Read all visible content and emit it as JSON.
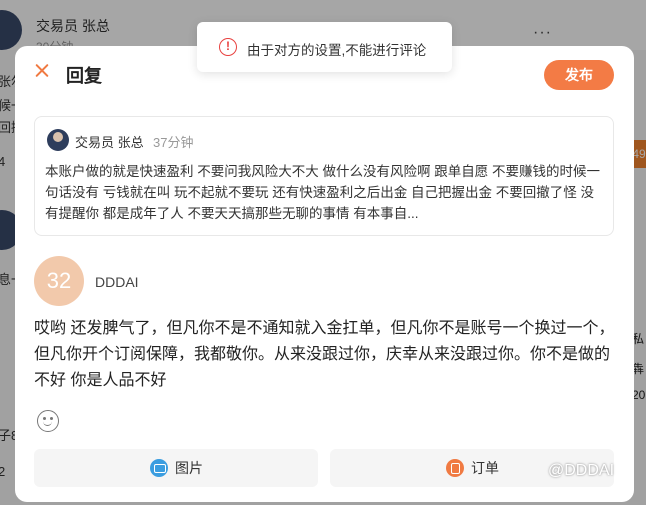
{
  "background": {
    "post_author": "交易员 张总",
    "post_time": "30分钟",
    "more_label": "···",
    "left_fragments": [
      "张尔",
      "候一",
      "回撤",
      "4",
      "息一",
      "子8",
      "2"
    ],
    "right_fragments": [
      "49",
      "私",
      "犇",
      "20"
    ]
  },
  "toast": {
    "icon": "exclamation-circle-icon",
    "icon_glyph": "!",
    "message": "由于对方的设置,不能进行评论",
    "color": "#e8413f"
  },
  "dialog": {
    "title": "回复",
    "publish_label": "发布",
    "accent_color": "#f37b45",
    "quoted": {
      "author": "交易员 张总",
      "time": "37分钟",
      "text": "本账户做的就是快速盈利 不要问我风险大不大 做什么没有风险啊 跟单自愿 不要赚钱的时候一句话没有 亏钱就在叫 玩不起就不要玩 还有快速盈利之后出金 自己把握出金 不要回撤了怪 没有提醒你 都是成年了人 不要天天搞那些无聊的事情 有本事自..."
    },
    "reply": {
      "avatar_text": "32",
      "username": "DDDAI",
      "text": "哎哟 还发脾气了，但凡你不是不通知就入金扛单，但凡你不是账号一个换过一个，但凡你开个订阅保障，我都敬你。从来没跟过你，庆幸从来没跟过你。你不是做的不好 你是人品不好"
    },
    "tools": {
      "emoji_icon": "smiley-icon",
      "image_label": "图片",
      "order_label": "订单"
    }
  },
  "watermark": "@DDDAI"
}
